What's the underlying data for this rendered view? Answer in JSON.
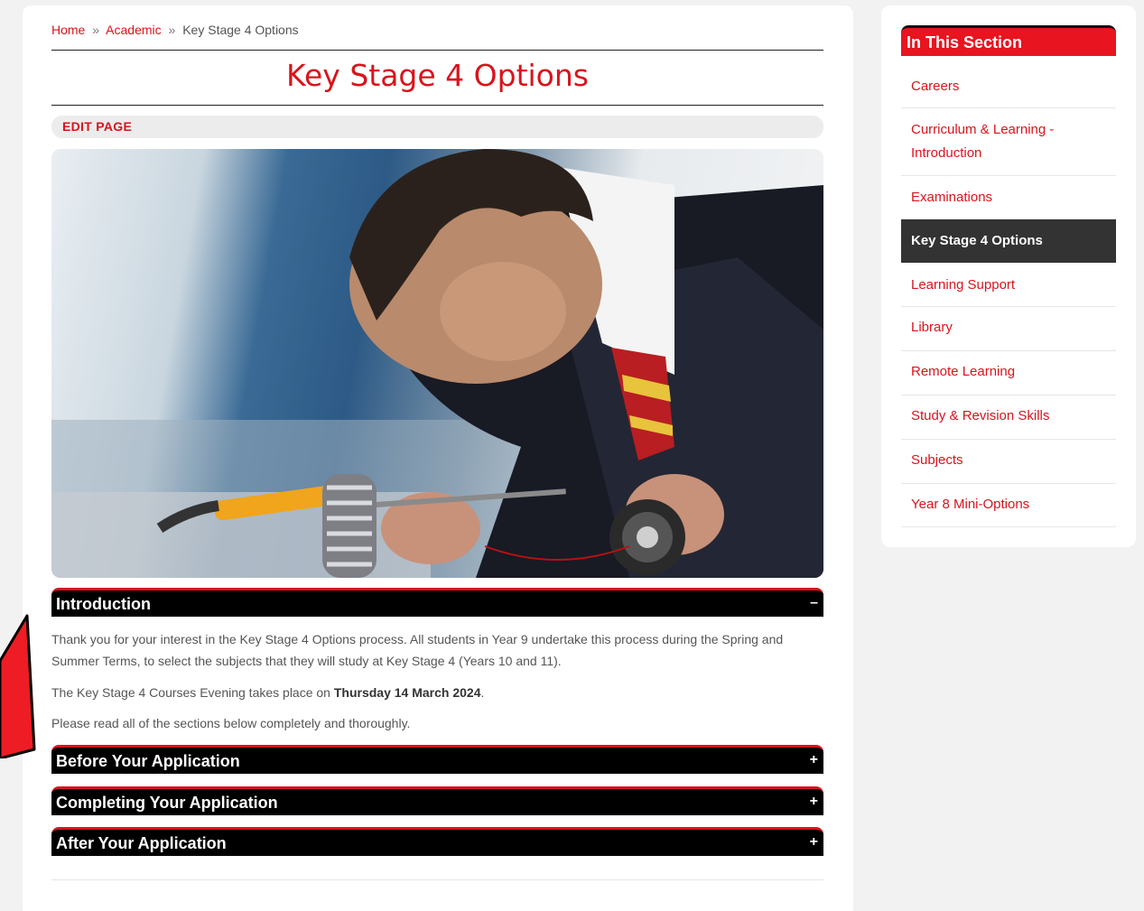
{
  "breadcrumb": {
    "home": "Home",
    "separator": "»",
    "academic": "Academic",
    "current": "Key Stage 4 Options"
  },
  "page": {
    "title": "Key Stage 4 Options",
    "edit_label": "EDIT PAGE"
  },
  "accordions": [
    {
      "title": "Introduction",
      "sign": "–",
      "expanded": true
    },
    {
      "title": "Before Your Application",
      "sign": "+",
      "expanded": false
    },
    {
      "title": "Completing Your Application",
      "sign": "+",
      "expanded": false
    },
    {
      "title": "After Your Application",
      "sign": "+",
      "expanded": false
    }
  ],
  "intro": {
    "para1": "Thank you for your interest in the Key Stage 4 Options process. All students in Year 9 undertake this process during the Spring and Summer Terms, to select the subjects that they will study at Key Stage 4 (Years 10 and 11).",
    "para2_prefix": "The Key Stage 4 Courses Evening takes place on ",
    "para2_bold": "Thursday 14 March 2024",
    "para2_suffix": ".",
    "para3": "Please read all of the sections below completely and thoroughly."
  },
  "sidebar": {
    "heading": "In This Section",
    "items": [
      {
        "label": "Careers"
      },
      {
        "label": "Curriculum & Learning - Introduction"
      },
      {
        "label": "Examinations"
      },
      {
        "label": "Key Stage 4 Options",
        "active": true
      },
      {
        "label": "Learning Support"
      },
      {
        "label": "Library"
      },
      {
        "label": "Remote Learning"
      },
      {
        "label": "Study & Revision Skills"
      },
      {
        "label": "Subjects"
      },
      {
        "label": "Year 8 Mini-Options"
      }
    ]
  },
  "colors": {
    "accent": "#d8141c",
    "sidebar_heading": "#e8141f",
    "accordion_bg": "#000000",
    "active_item_bg": "#333333"
  }
}
